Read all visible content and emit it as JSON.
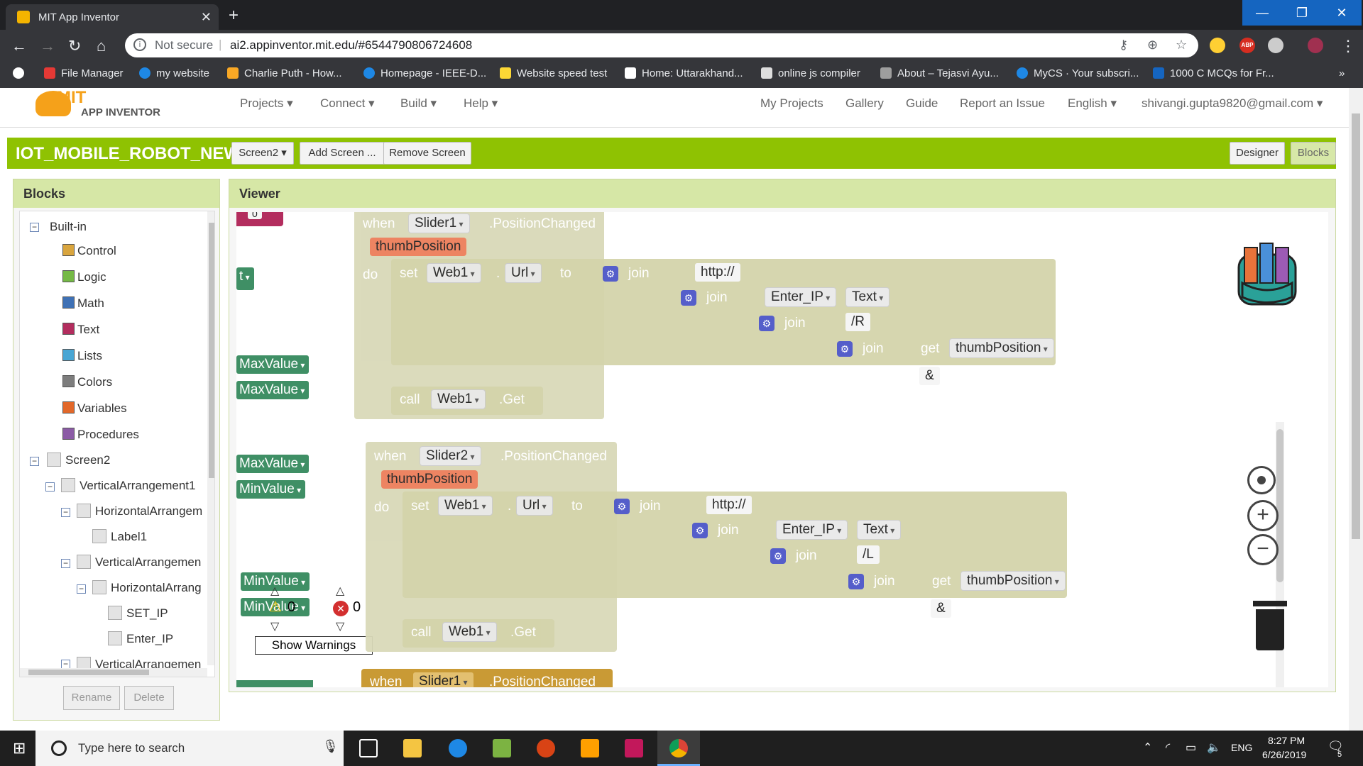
{
  "browser": {
    "tab_title": "MIT App Inventor",
    "url_not_secure": "Not secure",
    "url_separator": "|",
    "url": "ai2.appinventor.mit.edu/#6544790806724608",
    "bookmarks": [
      "File Manager",
      "my website",
      "Charlie Puth - How...",
      "Homepage - IEEE-D...",
      "Website speed test",
      "Home: Uttarakhand...",
      "online js compiler",
      "About – Tejasvi Ayu...",
      "MyCS · Your subscri...",
      "1000 C MCQs for Fr..."
    ],
    "more_bookmarks": "»",
    "ext_abp": "ABP"
  },
  "app": {
    "logo_mit": "MIT",
    "logo_sub": "APP INVENTOR",
    "menu_left": [
      "Projects ▾",
      "Connect ▾",
      "Build ▾",
      "Help ▾"
    ],
    "menu_right": [
      "My Projects",
      "Gallery",
      "Guide",
      "Report an Issue",
      "English ▾",
      "shivangi.gupta9820@gmail.com ▾"
    ],
    "project_name": "IOT_MOBILE_ROBOT_NEW",
    "screen_select": "Screen2 ▾",
    "add_screen": "Add Screen ...",
    "remove_screen": "Remove Screen",
    "designer": "Designer",
    "blocks_tab": "Blocks"
  },
  "blocks_panel": {
    "title": "Blocks",
    "builtin": "Built-in",
    "items": [
      {
        "label": "Control",
        "color": "#d9a53e"
      },
      {
        "label": "Logic",
        "color": "#75b946"
      },
      {
        "label": "Math",
        "color": "#3f71b5"
      },
      {
        "label": "Text",
        "color": "#b32d5e"
      },
      {
        "label": "Lists",
        "color": "#49a6d4"
      },
      {
        "label": "Colors",
        "color": "#7d7d7d"
      },
      {
        "label": "Variables",
        "color": "#e2682a"
      },
      {
        "label": "Procedures",
        "color": "#8b5ba5"
      }
    ],
    "components": [
      "Screen2",
      "VerticalArrangement1",
      "HorizontalArrangem",
      "Label1",
      "VerticalArrangemen",
      "HorizontalArrang",
      "SET_IP",
      "Enter_IP",
      "VerticalArrangemen"
    ],
    "rename": "Rename",
    "delete": "Delete"
  },
  "viewer": {
    "title": "Viewer",
    "block1": {
      "when": "when",
      "component": "Slider1",
      "event": ".PositionChanged",
      "param": "thumbPosition",
      "do": "do",
      "set": "set",
      "web": "Web1",
      "prop": "Url",
      "to": "to",
      "join": "join",
      "s1": "http://",
      "enter": "Enter_IP",
      "text": "Text",
      "s2": "/R",
      "get": "get",
      "var": "thumbPosition",
      "s3": "&",
      "call": "call",
      "method": ".Get"
    },
    "block2": {
      "when": "when",
      "component": "Slider2",
      "event": ".PositionChanged",
      "param": "thumbPosition",
      "do": "do",
      "set": "set",
      "web": "Web1",
      "prop": "Url",
      "to": "to",
      "join": "join",
      "s1": "http://",
      "enter": "Enter_IP",
      "text": "Text",
      "s2": "/L",
      "get": "get",
      "var": "thumbPosition",
      "s3": "&",
      "call": "call",
      "method": ".Get"
    },
    "block3": {
      "when": "when",
      "component": "Slider1",
      "event": ".PositionChanged"
    },
    "left_blocks": [
      "MaxValue",
      "MaxValue",
      "MaxValue",
      "MinValue",
      "MinValue",
      "MinValue"
    ],
    "partial_t": "t",
    "partial_zero": "0",
    "warning_count": "0",
    "error_count": "0",
    "show_warnings": "Show Warnings"
  },
  "taskbar": {
    "search_placeholder": "Type here to search",
    "lang": "ENG",
    "time": "8:27 PM",
    "date": "6/26/2019",
    "notif_count": "5"
  }
}
